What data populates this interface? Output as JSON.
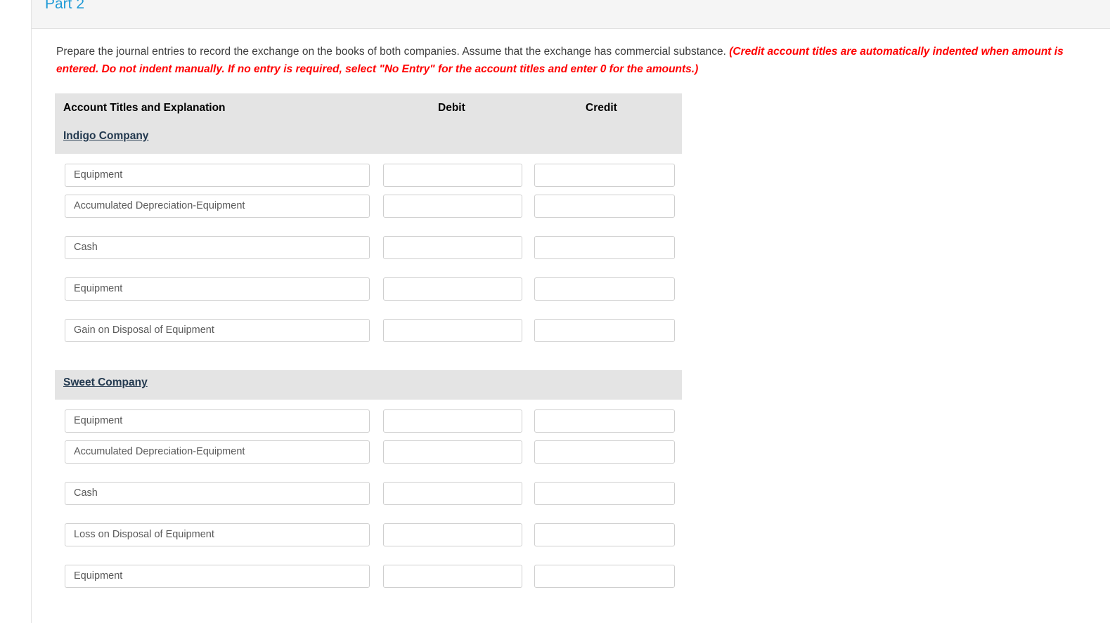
{
  "panel": {
    "header_title": "Part 2",
    "header_color": "#1f9ad6"
  },
  "instructions": {
    "main_text": "Prepare the journal entries to record the exchange on the books of both companies. Assume that the exchange has commercial substance. ",
    "note_text": "(Credit account titles are automatically indented when amount is entered. Do not indent manually. If no entry is required, select \"No Entry\" for the account titles and enter 0 for the amounts.)",
    "note_color": "#ff0000"
  },
  "journal": {
    "headers": {
      "account": "Account Titles and Explanation",
      "debit": "Debit",
      "credit": "Credit"
    },
    "sections": [
      {
        "company": "Indigo Company",
        "rows": [
          {
            "account": "Equipment",
            "debit": "",
            "credit": ""
          },
          {
            "account": "Accumulated Depreciation-Equipment",
            "debit": "",
            "credit": ""
          },
          {
            "account": "Cash",
            "debit": "",
            "credit": ""
          },
          {
            "account": "Equipment",
            "debit": "",
            "credit": ""
          },
          {
            "account": "Gain on Disposal of Equipment",
            "debit": "",
            "credit": ""
          }
        ]
      },
      {
        "company": "Sweet Company",
        "rows": [
          {
            "account": "Equipment",
            "debit": "",
            "credit": ""
          },
          {
            "account": "Accumulated Depreciation-Equipment",
            "debit": "",
            "credit": ""
          },
          {
            "account": "Cash",
            "debit": "",
            "credit": ""
          },
          {
            "account": "Loss on Disposal of Equipment",
            "debit": "",
            "credit": ""
          },
          {
            "account": "Equipment",
            "debit": "",
            "credit": ""
          }
        ]
      }
    ]
  }
}
